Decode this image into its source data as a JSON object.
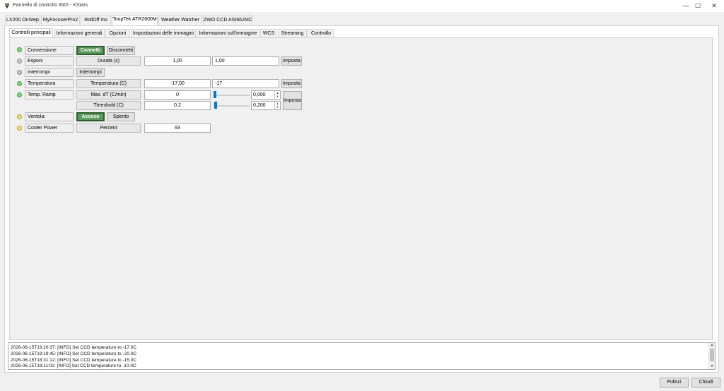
{
  "window": {
    "title": "Pannello di controllo INDI - KStars",
    "minimize": "—",
    "maximize": "☐",
    "close": "✕"
  },
  "device_tabs": [
    {
      "label": "LX200 OnStep"
    },
    {
      "label": "MyFocuserPro2"
    },
    {
      "label": "RollOff ino"
    },
    {
      "label": "ToupTek ATR2600M",
      "active": true
    },
    {
      "label": "Weather Watcher"
    },
    {
      "label": "ZWO CCD ASI662MC"
    }
  ],
  "group_tabs": [
    {
      "label": "Controlli principali",
      "active": true
    },
    {
      "label": "Informazioni generali"
    },
    {
      "label": "Opzioni"
    },
    {
      "label": "Impostazioni delle immagini"
    },
    {
      "label": "Informazioni sull'immagine"
    },
    {
      "label": "WCS"
    },
    {
      "label": "Streaming"
    },
    {
      "label": "Controllo"
    }
  ],
  "properties": {
    "connection": {
      "label": "Connessione",
      "connect": "Connetti",
      "disconnect": "Disconnetti",
      "led": "green"
    },
    "expose": {
      "label": "Esponi",
      "element": "Durata (s)",
      "value": "1,00",
      "input": "1,00",
      "set": "Imposta",
      "led": "gray"
    },
    "abort": {
      "label": "Interrompi",
      "button": "Interrompi",
      "led": "gray"
    },
    "temperature": {
      "label": "Temperatura",
      "element": "Temperatura (C)",
      "value": "-17,00",
      "input": "-17",
      "set": "Imposta",
      "led": "green"
    },
    "temp_ramp": {
      "label": "Temp. Ramp",
      "led": "green",
      "set": "Imposta",
      "max_dt": {
        "element": "Max. dT (C/min)",
        "value": "0",
        "spin": "0,000",
        "slider_fraction": 0.0
      },
      "threshold": {
        "element": "Threshold (C)",
        "value": "0.2",
        "spin": "0,200",
        "slider_fraction": 0.02
      }
    },
    "fan": {
      "label": "Ventola:",
      "on": "Acceso",
      "off": "Spento",
      "led": "yellow"
    },
    "cooler_power": {
      "label": "Cooler Power",
      "element": "Percent",
      "value": "93",
      "led": "yellow"
    }
  },
  "log": {
    "lines": [
      "2026-06-15T19:20:37: [INFO] Set CCD temperature to -17.0C",
      "2026-06-15T19:19:45: [INFO] Set CCD temperature to -20.0C",
      "2026-06-15T18:31:12: [INFO] Set CCD temperature to -15.0C",
      "2026-06-15T18:11:02: [INFO] Set CCD temperature to -10.0C"
    ]
  },
  "buttons": {
    "clear": "Pulisci",
    "close": "Chiudi"
  },
  "colors": {
    "on_button": "#5c9a5c",
    "led_green": "#7ed97e",
    "led_gray": "#c7c7c7",
    "led_yellow": "#f3e26e",
    "slider": "#0078d7"
  }
}
